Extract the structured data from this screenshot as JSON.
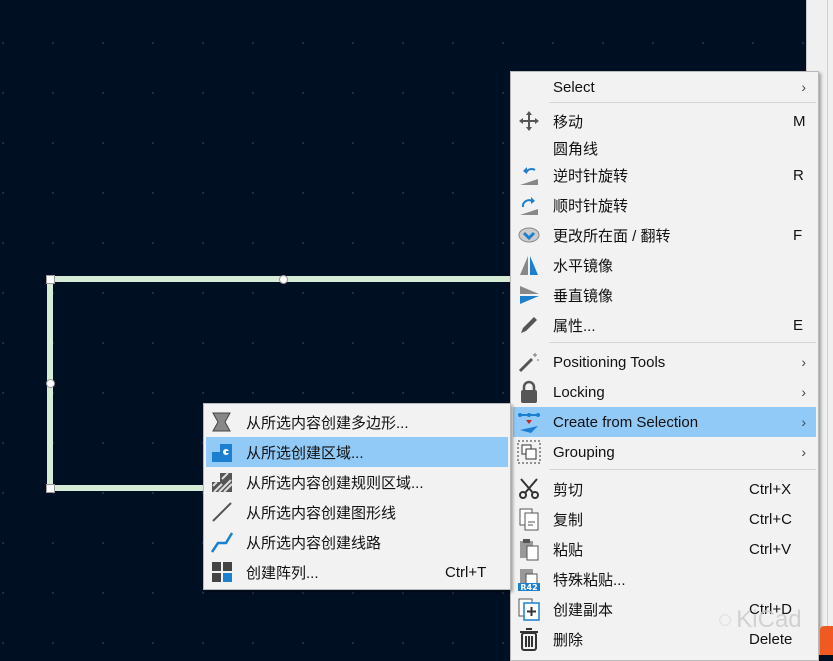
{
  "colors": {
    "canvas": "#001023",
    "highlight": "#91c9f7",
    "shape": "#d6ecd6",
    "icon_blue": "#1c7fd0"
  },
  "context_menu": {
    "items": [
      {
        "label": "Select",
        "shortcut": "",
        "submenu": true,
        "icon": ""
      },
      {
        "label": "移动",
        "shortcut": "M",
        "icon": "move-icon"
      },
      {
        "label": "圆角线",
        "shortcut": "",
        "icon": ""
      },
      {
        "label": "逆时针旋转",
        "shortcut": "R",
        "icon": "rotate-ccw-icon"
      },
      {
        "label": "顺时针旋转",
        "shortcut": "",
        "icon": "rotate-cw-icon"
      },
      {
        "label": "更改所在面 / 翻转",
        "shortcut": "F",
        "icon": "flip-icon"
      },
      {
        "label": "水平镜像",
        "shortcut": "",
        "icon": "mirror-horizontal-icon"
      },
      {
        "label": "垂直镜像",
        "shortcut": "",
        "icon": "mirror-vertical-icon"
      },
      {
        "label": "属性...",
        "shortcut": "E",
        "icon": "pencil-icon"
      },
      {
        "label": "Positioning Tools",
        "shortcut": "",
        "submenu": true,
        "icon": "magic-wand-icon"
      },
      {
        "label": "Locking",
        "shortcut": "",
        "submenu": true,
        "icon": "lock-icon"
      },
      {
        "label": "Create from Selection",
        "shortcut": "",
        "submenu": true,
        "icon": "create-from-selection-icon",
        "highlighted": true
      },
      {
        "label": "Grouping",
        "shortcut": "",
        "submenu": true,
        "icon": "group-icon"
      },
      {
        "label": "剪切",
        "shortcut": "Ctrl+X",
        "icon": "scissors-icon"
      },
      {
        "label": "复制",
        "shortcut": "Ctrl+C",
        "icon": "copy-icon"
      },
      {
        "label": "粘贴",
        "shortcut": "Ctrl+V",
        "icon": "paste-icon"
      },
      {
        "label": "特殊粘贴...",
        "shortcut": "",
        "icon": "paste-special-icon",
        "badge": "R42"
      },
      {
        "label": "创建副本",
        "shortcut": "Ctrl+D",
        "icon": "duplicate-icon"
      },
      {
        "label": "删除",
        "shortcut": "Delete",
        "icon": "trash-icon"
      }
    ]
  },
  "submenu": {
    "items": [
      {
        "label": "从所选内容创建多边形...",
        "shortcut": "",
        "icon": "polygon-icon"
      },
      {
        "label": "从所选创建区域...",
        "shortcut": "",
        "icon": "zone-icon",
        "highlighted": true
      },
      {
        "label": "从所选内容创建规则区域...",
        "shortcut": "",
        "icon": "rule-area-icon"
      },
      {
        "label": "从所选内容创建图形线",
        "shortcut": "",
        "icon": "graphic-line-icon"
      },
      {
        "label": "从所选内容创建线路",
        "shortcut": "",
        "icon": "track-icon"
      },
      {
        "label": "创建阵列...",
        "shortcut": "Ctrl+T",
        "icon": "array-icon"
      }
    ]
  },
  "watermark": "KiCad"
}
